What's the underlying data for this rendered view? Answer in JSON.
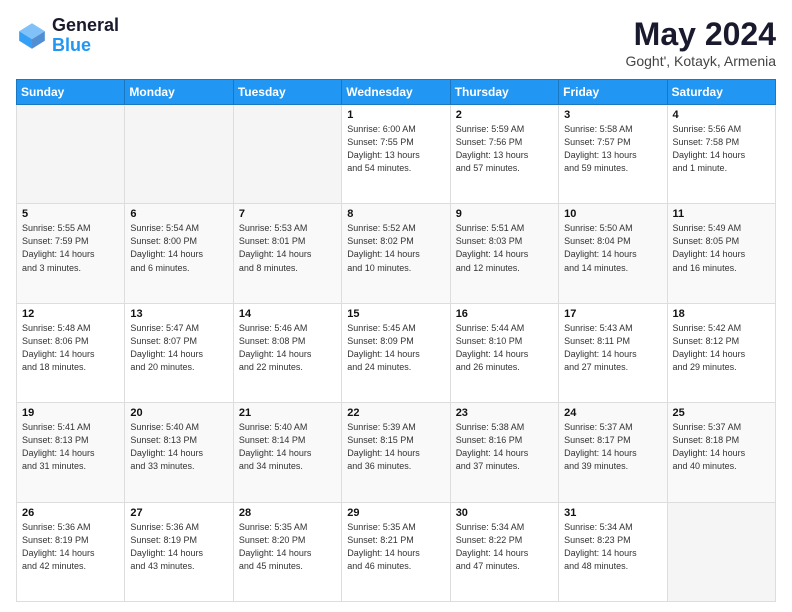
{
  "header": {
    "logo_line1": "General",
    "logo_line2": "Blue",
    "main_title": "May 2024",
    "subtitle": "Goght', Kotayk, Armenia"
  },
  "calendar": {
    "days_of_week": [
      "Sunday",
      "Monday",
      "Tuesday",
      "Wednesday",
      "Thursday",
      "Friday",
      "Saturday"
    ],
    "weeks": [
      [
        {
          "day": "",
          "info": ""
        },
        {
          "day": "",
          "info": ""
        },
        {
          "day": "",
          "info": ""
        },
        {
          "day": "1",
          "info": "Sunrise: 6:00 AM\nSunset: 7:55 PM\nDaylight: 13 hours\nand 54 minutes."
        },
        {
          "day": "2",
          "info": "Sunrise: 5:59 AM\nSunset: 7:56 PM\nDaylight: 13 hours\nand 57 minutes."
        },
        {
          "day": "3",
          "info": "Sunrise: 5:58 AM\nSunset: 7:57 PM\nDaylight: 13 hours\nand 59 minutes."
        },
        {
          "day": "4",
          "info": "Sunrise: 5:56 AM\nSunset: 7:58 PM\nDaylight: 14 hours\nand 1 minute."
        }
      ],
      [
        {
          "day": "5",
          "info": "Sunrise: 5:55 AM\nSunset: 7:59 PM\nDaylight: 14 hours\nand 3 minutes."
        },
        {
          "day": "6",
          "info": "Sunrise: 5:54 AM\nSunset: 8:00 PM\nDaylight: 14 hours\nand 6 minutes."
        },
        {
          "day": "7",
          "info": "Sunrise: 5:53 AM\nSunset: 8:01 PM\nDaylight: 14 hours\nand 8 minutes."
        },
        {
          "day": "8",
          "info": "Sunrise: 5:52 AM\nSunset: 8:02 PM\nDaylight: 14 hours\nand 10 minutes."
        },
        {
          "day": "9",
          "info": "Sunrise: 5:51 AM\nSunset: 8:03 PM\nDaylight: 14 hours\nand 12 minutes."
        },
        {
          "day": "10",
          "info": "Sunrise: 5:50 AM\nSunset: 8:04 PM\nDaylight: 14 hours\nand 14 minutes."
        },
        {
          "day": "11",
          "info": "Sunrise: 5:49 AM\nSunset: 8:05 PM\nDaylight: 14 hours\nand 16 minutes."
        }
      ],
      [
        {
          "day": "12",
          "info": "Sunrise: 5:48 AM\nSunset: 8:06 PM\nDaylight: 14 hours\nand 18 minutes."
        },
        {
          "day": "13",
          "info": "Sunrise: 5:47 AM\nSunset: 8:07 PM\nDaylight: 14 hours\nand 20 minutes."
        },
        {
          "day": "14",
          "info": "Sunrise: 5:46 AM\nSunset: 8:08 PM\nDaylight: 14 hours\nand 22 minutes."
        },
        {
          "day": "15",
          "info": "Sunrise: 5:45 AM\nSunset: 8:09 PM\nDaylight: 14 hours\nand 24 minutes."
        },
        {
          "day": "16",
          "info": "Sunrise: 5:44 AM\nSunset: 8:10 PM\nDaylight: 14 hours\nand 26 minutes."
        },
        {
          "day": "17",
          "info": "Sunrise: 5:43 AM\nSunset: 8:11 PM\nDaylight: 14 hours\nand 27 minutes."
        },
        {
          "day": "18",
          "info": "Sunrise: 5:42 AM\nSunset: 8:12 PM\nDaylight: 14 hours\nand 29 minutes."
        }
      ],
      [
        {
          "day": "19",
          "info": "Sunrise: 5:41 AM\nSunset: 8:13 PM\nDaylight: 14 hours\nand 31 minutes."
        },
        {
          "day": "20",
          "info": "Sunrise: 5:40 AM\nSunset: 8:13 PM\nDaylight: 14 hours\nand 33 minutes."
        },
        {
          "day": "21",
          "info": "Sunrise: 5:40 AM\nSunset: 8:14 PM\nDaylight: 14 hours\nand 34 minutes."
        },
        {
          "day": "22",
          "info": "Sunrise: 5:39 AM\nSunset: 8:15 PM\nDaylight: 14 hours\nand 36 minutes."
        },
        {
          "day": "23",
          "info": "Sunrise: 5:38 AM\nSunset: 8:16 PM\nDaylight: 14 hours\nand 37 minutes."
        },
        {
          "day": "24",
          "info": "Sunrise: 5:37 AM\nSunset: 8:17 PM\nDaylight: 14 hours\nand 39 minutes."
        },
        {
          "day": "25",
          "info": "Sunrise: 5:37 AM\nSunset: 8:18 PM\nDaylight: 14 hours\nand 40 minutes."
        }
      ],
      [
        {
          "day": "26",
          "info": "Sunrise: 5:36 AM\nSunset: 8:19 PM\nDaylight: 14 hours\nand 42 minutes."
        },
        {
          "day": "27",
          "info": "Sunrise: 5:36 AM\nSunset: 8:19 PM\nDaylight: 14 hours\nand 43 minutes."
        },
        {
          "day": "28",
          "info": "Sunrise: 5:35 AM\nSunset: 8:20 PM\nDaylight: 14 hours\nand 45 minutes."
        },
        {
          "day": "29",
          "info": "Sunrise: 5:35 AM\nSunset: 8:21 PM\nDaylight: 14 hours\nand 46 minutes."
        },
        {
          "day": "30",
          "info": "Sunrise: 5:34 AM\nSunset: 8:22 PM\nDaylight: 14 hours\nand 47 minutes."
        },
        {
          "day": "31",
          "info": "Sunrise: 5:34 AM\nSunset: 8:23 PM\nDaylight: 14 hours\nand 48 minutes."
        },
        {
          "day": "",
          "info": ""
        }
      ]
    ]
  }
}
